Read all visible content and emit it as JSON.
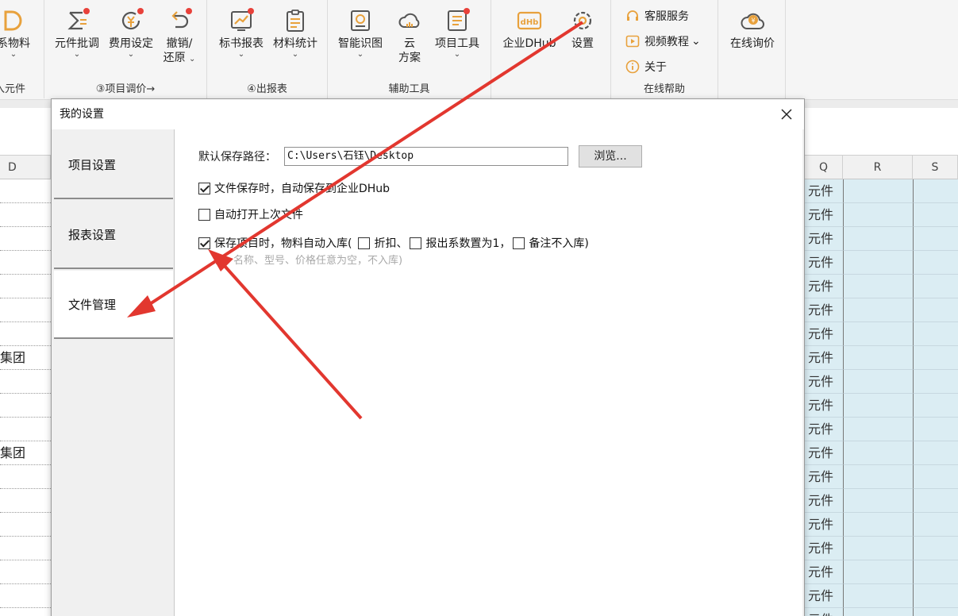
{
  "ribbon": {
    "groups": [
      {
        "label": "录入元件",
        "items": [
          {
            "label": "系物料"
          }
        ]
      },
      {
        "label": "③项目调价→",
        "items": [
          {
            "label": "元件批调"
          },
          {
            "label": "费用设定"
          },
          {
            "label": "撤销/",
            "label2": "还原"
          }
        ]
      },
      {
        "label": "④出报表",
        "items": [
          {
            "label": "标书报表"
          },
          {
            "label": "材料统计"
          }
        ]
      },
      {
        "label": "辅助工具",
        "items": [
          {
            "label": "智能识图"
          },
          {
            "label": "云",
            "label2": "方案"
          },
          {
            "label": "项目工具"
          }
        ]
      },
      {
        "label": "",
        "items": [
          {
            "label": "企业DHub"
          },
          {
            "label": "设置"
          }
        ]
      },
      {
        "label": "在线帮助",
        "items": [
          {
            "label": "客服服务"
          },
          {
            "label": "视频教程"
          },
          {
            "label": "关于"
          }
        ]
      },
      {
        "label": "",
        "items": [
          {
            "label": "在线询价"
          }
        ]
      }
    ]
  },
  "sheet": {
    "col_d": "D",
    "col_q": "Q",
    "col_r": "R",
    "col_s": "S",
    "left_cells": [
      "",
      "",
      "",
      "",
      "",
      "",
      "",
      "集团",
      "",
      "",
      "",
      "集团",
      "",
      "",
      "",
      "",
      "",
      "",
      ""
    ],
    "q_value": "元件"
  },
  "dialog": {
    "title": "我的设置",
    "nav": [
      "项目设置",
      "报表设置",
      "文件管理"
    ],
    "active_nav": 2,
    "path_label": "默认保存路径：",
    "path_value": "C:\\Users\\石钰\\Desktop",
    "browse_label": "浏览...",
    "checks": [
      {
        "label": "文件保存时，自动保存到企业DHub",
        "checked": true
      },
      {
        "label": "自动打开上次文件",
        "checked": false
      }
    ],
    "auto_stock": {
      "label": "保存项目时，物料自动入库(",
      "checked": true,
      "sub": [
        {
          "label": "折扣、",
          "checked": false
        },
        {
          "label": "报出系数置为1，",
          "checked": false
        },
        {
          "label": "备注不入库)",
          "checked": false
        }
      ]
    },
    "note": "注：名称、型号、价格任意为空，不入库)"
  },
  "colors": {
    "accent": "#e2372f",
    "icon_orange": "#e8a13c",
    "icon_grey": "#555555",
    "cell_blue": "#dbedf3"
  }
}
